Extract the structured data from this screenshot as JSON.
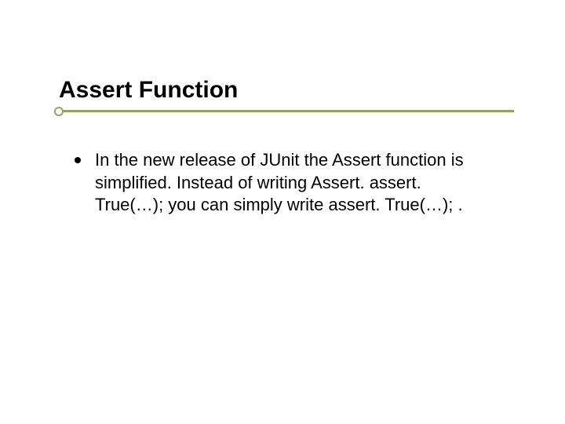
{
  "slide": {
    "title": "Assert Function",
    "bullets": [
      "In the new release of JUnit the Assert function is simplified.  Instead of writing Assert. assert. True(…); you can simply write assert. True(…); ."
    ],
    "accent_color": "#8fa663"
  }
}
